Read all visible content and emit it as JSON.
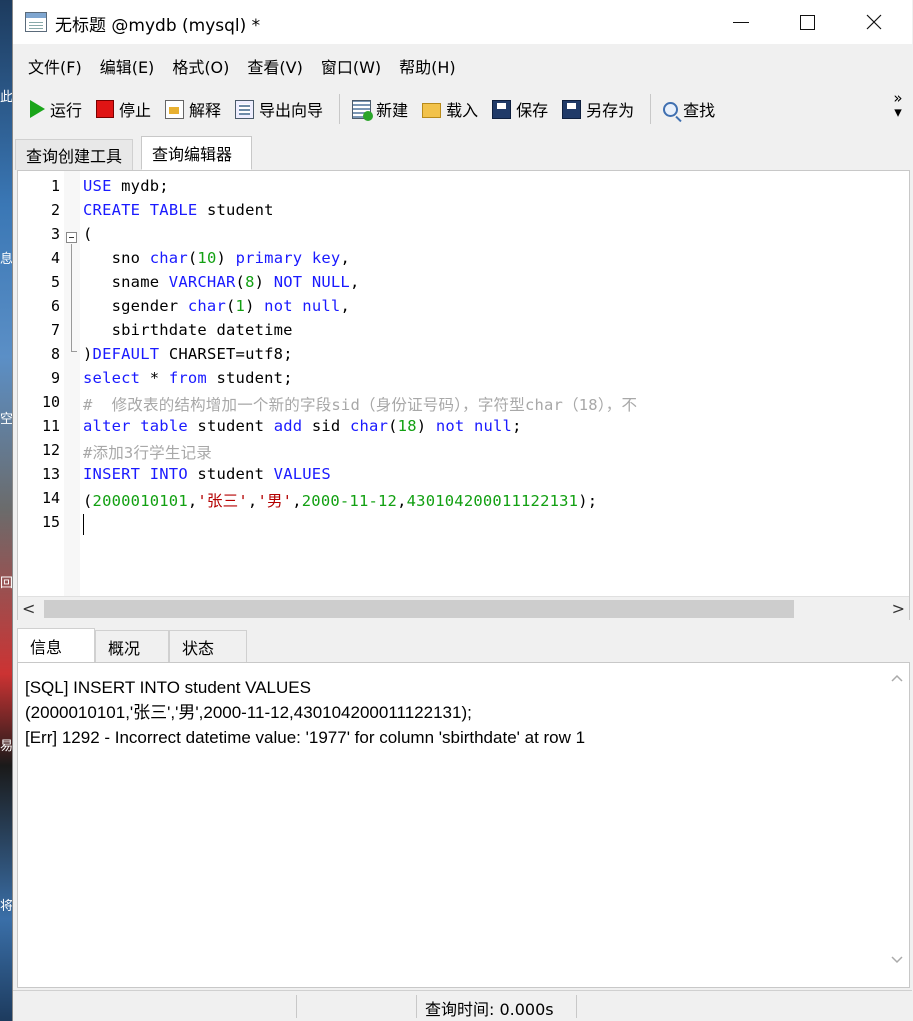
{
  "window": {
    "title": "无标题 @mydb (mysql) *"
  },
  "menu": {
    "items": [
      "文件(F)",
      "编辑(E)",
      "格式(O)",
      "查看(V)",
      "窗口(W)",
      "帮助(H)"
    ]
  },
  "toolbar": {
    "run": "运行",
    "stop": "停止",
    "explain": "解释",
    "export": "导出向导",
    "new": "新建",
    "load": "载入",
    "save": "保存",
    "save_as": "另存为",
    "find": "查找",
    "more": "»"
  },
  "editor_tabs": {
    "builder": "查询创建工具",
    "editor": "查询编辑器"
  },
  "editor": {
    "line_numbers": [
      "1",
      "2",
      "3",
      "4",
      "5",
      "6",
      "7",
      "8",
      "9",
      "10",
      "11",
      "12",
      "13",
      "14",
      "15"
    ],
    "lines": [
      [
        [
          "kw",
          "USE"
        ],
        [
          "t",
          " mydb;"
        ]
      ],
      [
        [
          "kw",
          "CREATE"
        ],
        [
          "t",
          " "
        ],
        [
          "kw",
          "TABLE"
        ],
        [
          "t",
          " student"
        ]
      ],
      [
        [
          "t",
          "("
        ]
      ],
      [
        [
          "t",
          "   sno "
        ],
        [
          "kw",
          "char"
        ],
        [
          "t",
          "("
        ],
        [
          "num",
          "10"
        ],
        [
          "t",
          ") "
        ],
        [
          "kw",
          "primary key"
        ],
        [
          "t",
          ","
        ]
      ],
      [
        [
          "t",
          "   sname "
        ],
        [
          "kw",
          "VARCHAR"
        ],
        [
          "t",
          "("
        ],
        [
          "num",
          "8"
        ],
        [
          "t",
          ") "
        ],
        [
          "kw",
          "NOT NULL"
        ],
        [
          "t",
          ","
        ]
      ],
      [
        [
          "t",
          "   sgender "
        ],
        [
          "kw",
          "char"
        ],
        [
          "t",
          "("
        ],
        [
          "num",
          "1"
        ],
        [
          "t",
          ") "
        ],
        [
          "kw",
          "not null"
        ],
        [
          "t",
          ","
        ]
      ],
      [
        [
          "t",
          "   sbirthdate datetime"
        ]
      ],
      [
        [
          "t",
          ")"
        ],
        [
          "kw",
          "DEFAULT"
        ],
        [
          "t",
          " CHARSET=utf8;"
        ]
      ],
      [
        [
          "kw",
          "select"
        ],
        [
          "t",
          " * "
        ],
        [
          "kw",
          "from"
        ],
        [
          "t",
          " student;"
        ]
      ],
      [
        [
          "cmt",
          "#  修改表的结构增加一个新的字段sid（身份证号码），字符型char（18），不"
        ]
      ],
      [
        [
          "kw",
          "alter"
        ],
        [
          "t",
          " "
        ],
        [
          "kw",
          "table"
        ],
        [
          "t",
          " student "
        ],
        [
          "kw",
          "add"
        ],
        [
          "t",
          " sid "
        ],
        [
          "kw",
          "char"
        ],
        [
          "t",
          "("
        ],
        [
          "num",
          "18"
        ],
        [
          "t",
          ") "
        ],
        [
          "kw",
          "not null"
        ],
        [
          "t",
          ";"
        ]
      ],
      [
        [
          "cmt",
          "#添加3行学生记录"
        ]
      ],
      [
        [
          "kw",
          "INSERT INTO"
        ],
        [
          "t",
          " student "
        ],
        [
          "kw",
          "VALUES"
        ]
      ],
      [
        [
          "t",
          "("
        ],
        [
          "num",
          "2000010101"
        ],
        [
          "t",
          ","
        ],
        [
          "str",
          "'张三'"
        ],
        [
          "t",
          ","
        ],
        [
          "str",
          "'男'"
        ],
        [
          "t",
          ","
        ],
        [
          "num",
          "2000-11-12"
        ],
        [
          "t",
          ","
        ],
        [
          "num",
          "430104200011122131"
        ],
        [
          "t",
          ");"
        ]
      ],
      [
        [
          "t",
          ""
        ]
      ]
    ]
  },
  "scroll": {
    "left_arrow": "<",
    "right_arrow": ">",
    "up_arrow": "^",
    "down_arrow": "v"
  },
  "bottom_tabs": {
    "info": "信息",
    "overview": "概况",
    "status": "状态"
  },
  "info": {
    "lines": [
      "[SQL] INSERT INTO student VALUES",
      "(2000010101,'张三','男',2000-11-12,430104200011122131);",
      "[Err] 1292 - Incorrect datetime value: '1977' for column 'sbirthdate' at row 1"
    ]
  },
  "statusbar": {
    "query_time": "查询时间: 0.000s"
  },
  "desktop": {
    "glyphs": [
      "此",
      "息",
      "空",
      "回",
      "易",
      "将"
    ]
  }
}
